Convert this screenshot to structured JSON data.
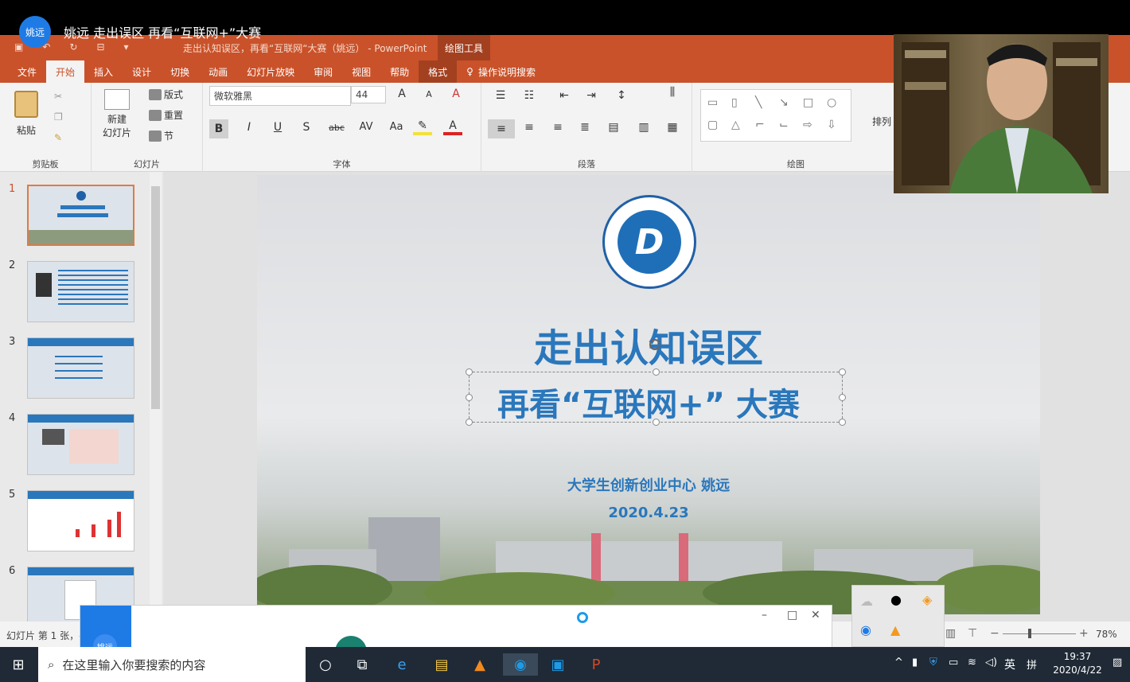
{
  "meeting": {
    "avatar_label": "姚远",
    "title": "姚远 走出误区 再看“互联网+”大赛"
  },
  "window": {
    "doc_title": "走出认知误区，再看“互联网“大赛（姚远） - PowerPoint",
    "context_tool": "绘图工具"
  },
  "tabs": [
    "文件",
    "开始",
    "插入",
    "设计",
    "切换",
    "动画",
    "幻灯片放映",
    "审阅",
    "视图",
    "帮助",
    "格式"
  ],
  "tell_me": "操作说明搜索",
  "ribbon": {
    "clipboard": {
      "paste": "粘贴",
      "label": "剪贴板"
    },
    "slides": {
      "new_slide": "新建\n幻灯片",
      "layout": "版式",
      "reset": "重置",
      "section": "节",
      "label": "幻灯片"
    },
    "font": {
      "name": "微软雅黑",
      "size": "44",
      "bold": "B",
      "italic": "I",
      "underline": "U",
      "shadow": "S",
      "strike": "abc",
      "spacing": "AV",
      "case": "Aa",
      "label": "字体"
    },
    "paragraph": {
      "label": "段落"
    },
    "drawing": {
      "label": "绘图",
      "arrange": "排列"
    }
  },
  "thumbnails": [
    {
      "num": "1"
    },
    {
      "num": "2"
    },
    {
      "num": "3"
    },
    {
      "num": "4"
    },
    {
      "num": "5"
    },
    {
      "num": "6"
    }
  ],
  "slide": {
    "title": "走出认知误区",
    "subtitle": "再看“互联网+” 大赛",
    "author": "大学生创新创业中心  姚远",
    "date": "2020.4.23",
    "logo_letter": "D"
  },
  "status": {
    "left": "幻灯片 第 1 张，共",
    "zoom": "78%"
  },
  "popup": {
    "avatar_label": "姚远"
  },
  "taskbar": {
    "search_placeholder": "在这里输入你要搜索的内容",
    "ime": "英",
    "ime2": "拼",
    "time": "19:37",
    "date": "2020/4/22"
  },
  "colors": {
    "ppt_accent": "#c9522a",
    "slide_text": "#2a77bc"
  }
}
